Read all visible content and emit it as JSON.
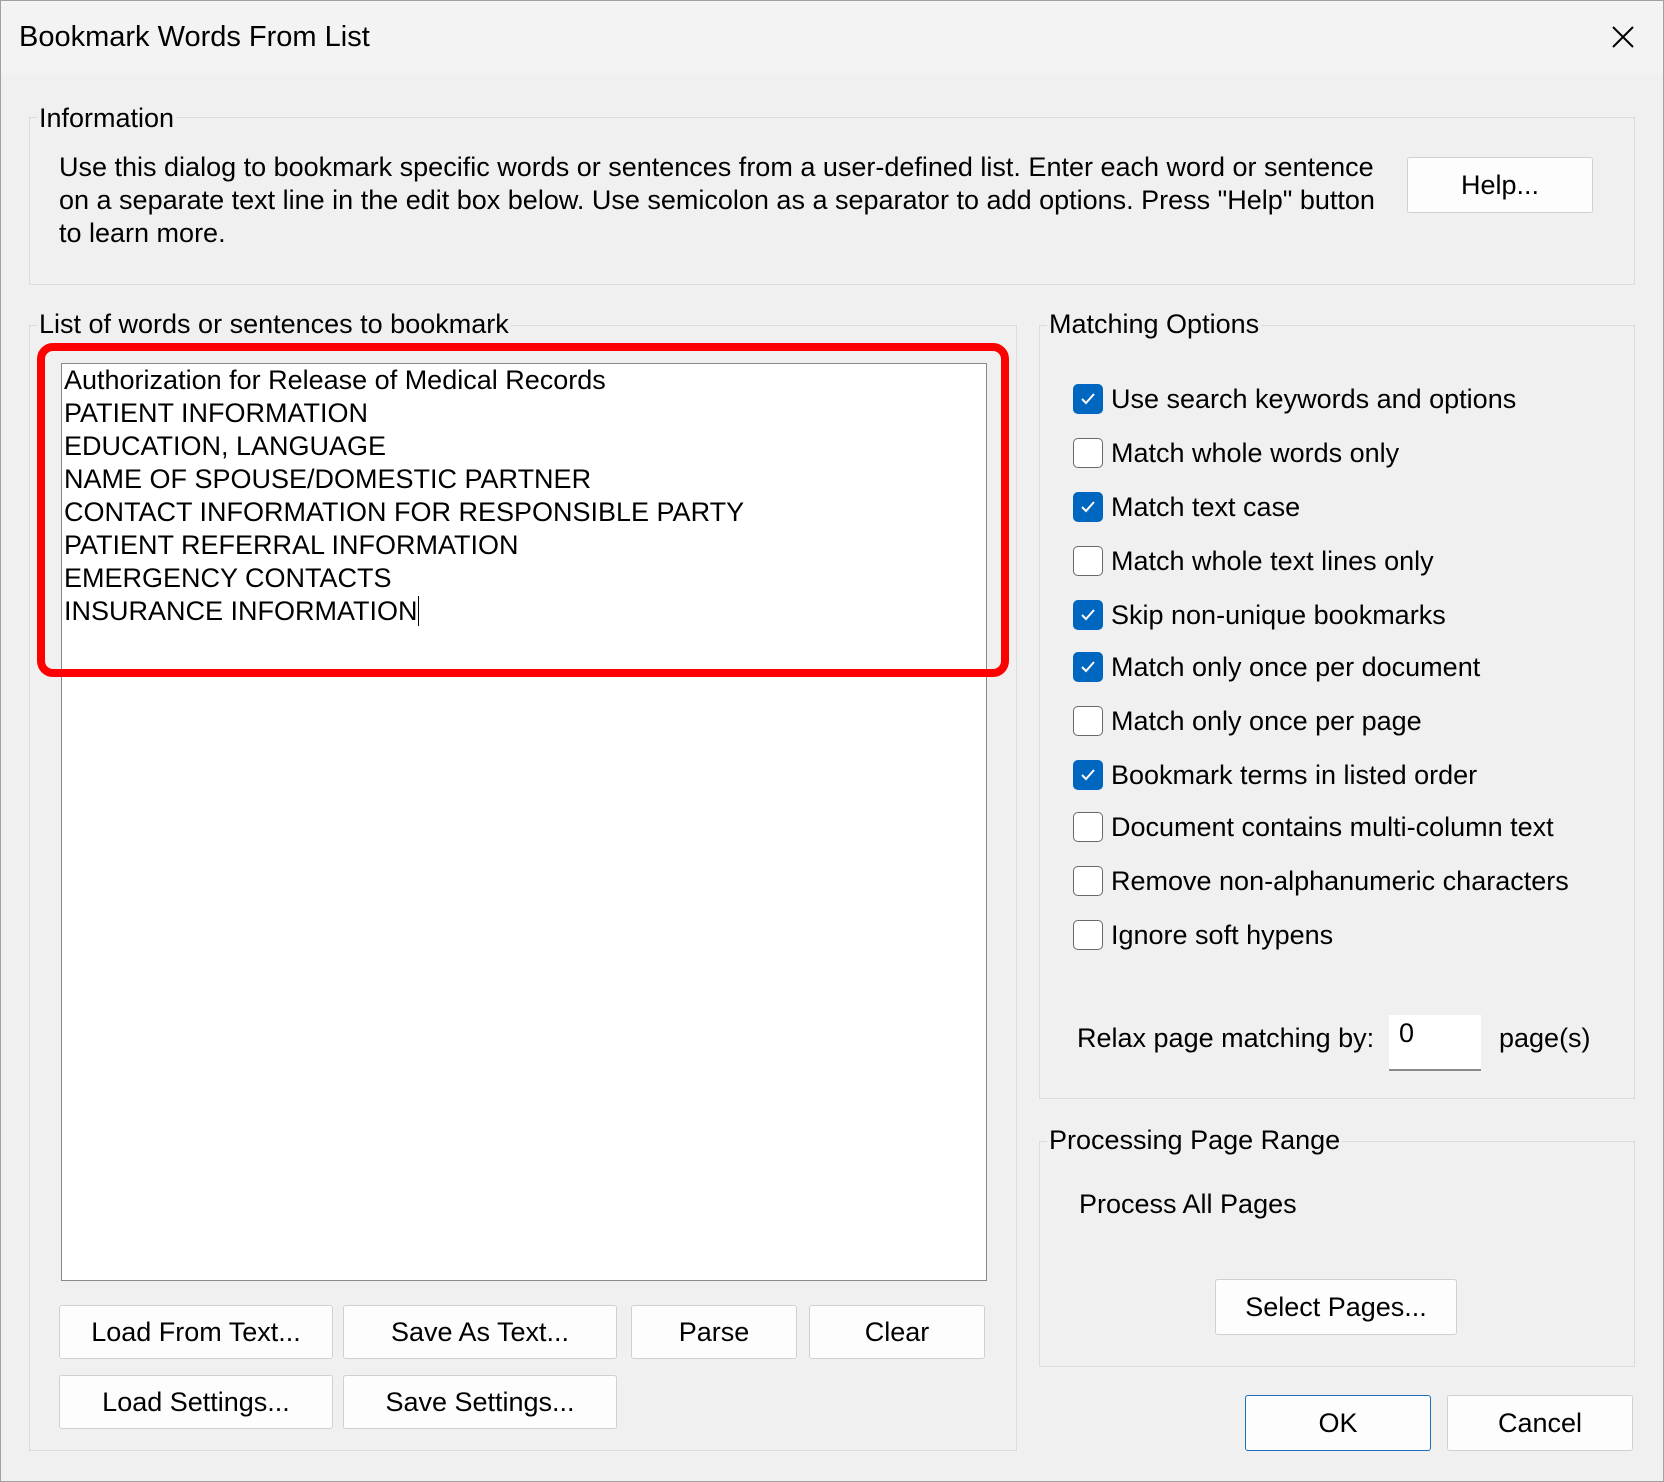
{
  "window": {
    "title": "Bookmark Words From List"
  },
  "information": {
    "label": "Information",
    "text": "Use this dialog to bookmark specific words or sentences from a user-defined list. Enter each word or sentence on a separate text line in the edit box below. Use semicolon as a separator to add options. Press \"Help\" button to learn more.",
    "help_button": "Help..."
  },
  "word_list": {
    "label": "List of words or sentences to bookmark",
    "lines": [
      "Authorization for Release of Medical Records",
      "PATIENT INFORMATION",
      "EDUCATION, LANGUAGE",
      "NAME OF SPOUSE/DOMESTIC PARTNER",
      "CONTACT INFORMATION FOR RESPONSIBLE PARTY",
      "PATIENT REFERRAL INFORMATION",
      "EMERGENCY CONTACTS",
      "INSURANCE INFORMATION"
    ],
    "buttons": {
      "load_from_text": "Load From Text...",
      "save_as_text": "Save As Text...",
      "parse": "Parse",
      "clear": "Clear",
      "load_settings": "Load Settings...",
      "save_settings": "Save Settings..."
    }
  },
  "matching_options": {
    "label": "Matching Options",
    "options": [
      {
        "label": "Use search keywords and options",
        "checked": true
      },
      {
        "label": "Match whole words only",
        "checked": false
      },
      {
        "label": "Match text case",
        "checked": true
      },
      {
        "label": "Match whole text lines only",
        "checked": false
      },
      {
        "label": "Skip non-unique bookmarks",
        "checked": true
      },
      {
        "label": "Match only once per document",
        "checked": true
      },
      {
        "label": "Match only once per page",
        "checked": false
      },
      {
        "label": "Bookmark terms in listed order",
        "checked": true
      },
      {
        "label": "Document contains multi-column text",
        "checked": false
      },
      {
        "label": "Remove non-alphanumeric characters",
        "checked": false
      },
      {
        "label": "Ignore soft hypens",
        "checked": false
      }
    ],
    "relax_label": "Relax page matching by:",
    "relax_value": "0",
    "relax_unit": "page(s)"
  },
  "page_range": {
    "label": "Processing Page Range",
    "value": "Process All Pages",
    "select_button": "Select Pages..."
  },
  "footer": {
    "ok": "OK",
    "cancel": "Cancel"
  },
  "colors": {
    "checkbox_checked": "#0067c0",
    "highlight": "#ff0000",
    "ok_border": "#1a6fbf"
  }
}
